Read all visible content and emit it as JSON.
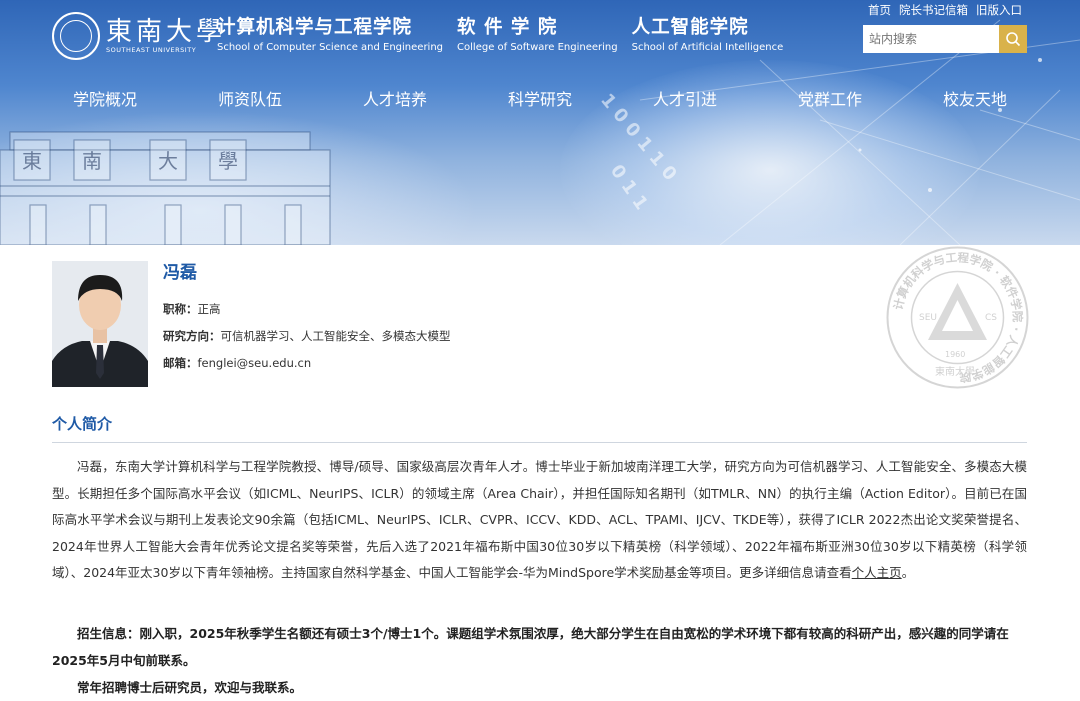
{
  "header": {
    "university_cn": "東南大學",
    "university_en": "SOUTHEAST UNIVERSITY",
    "schools": [
      {
        "cn": "计算机科学与工程学院",
        "en": "School of Computer Science and Engineering"
      },
      {
        "cn": "软 件 学 院",
        "en": "College of Software Engineering"
      },
      {
        "cn": "人工智能学院",
        "en": "School of Artificial Intelligence"
      }
    ],
    "top_links": [
      "首页",
      "院长书记信箱",
      "旧版入口"
    ],
    "search_placeholder": "站内搜索",
    "gate_chars": [
      "東",
      "南",
      "大",
      "學"
    ]
  },
  "nav": [
    "学院概况",
    "师资队伍",
    "人才培养",
    "科学研究",
    "人才引进",
    "党群工作",
    "校友天地"
  ],
  "emblem": {
    "ring_text": "计算机科学与工程学院 · 软件学院 · 人工智能学院",
    "left": "SEU",
    "right": "CS",
    "year": "1960",
    "bottom": "東南大學"
  },
  "profile": {
    "name": "冯磊",
    "title_label": "职称：",
    "title": "正高",
    "research_label": "研究方向：",
    "research": "可信机器学习、人工智能安全、多模态大模型",
    "email_label": "邮箱：",
    "email": "fenglei@seu.edu.cn"
  },
  "section_title": "个人简介",
  "bio": {
    "text": "冯磊，东南大学计算机科学与工程学院教授、博导/硕导、国家级高层次青年人才。博士毕业于新加坡南洋理工大学，研究方向为可信机器学习、人工智能安全、多模态大模型。长期担任多个国际高水平会议（如ICML、NeurIPS、ICLR）的领域主席（Area Chair），并担任国际知名期刊（如TMLR、NN）的执行主编（Action Editor）。目前已在国际高水平学术会议与期刊上发表论文90余篇（包括ICML、NeurIPS、ICLR、CVPR、ICCV、KDD、ACL、TPAMI、IJCV、TKDE等），获得了ICLR 2022杰出论文奖荣誉提名、2024年世界人工智能大会青年优秀论文提名奖等荣誉，先后入选了2021年福布斯中国30位30岁以下精英榜（科学领域）、2022年福布斯亚洲30位30岁以下精英榜（科学领域）、2024年亚太30岁以下青年领袖榜。主持国家自然科学基金、中国人工智能学会-华为MindSpore学术奖励基金等项目。更多详细信息请查看",
    "link": "个人主页",
    "end": "。"
  },
  "recruit": {
    "line1": "招生信息：刚入职，2025年秋季学生名额还有硕士3个/博士1个。课题组学术氛围浓厚，绝大部分学生在自由宽松的学术环境下都有较高的科研产出，感兴趣的同学请在2025年5月中旬前联系。",
    "line2": "常年招聘博士后研究员，欢迎与我联系。"
  }
}
